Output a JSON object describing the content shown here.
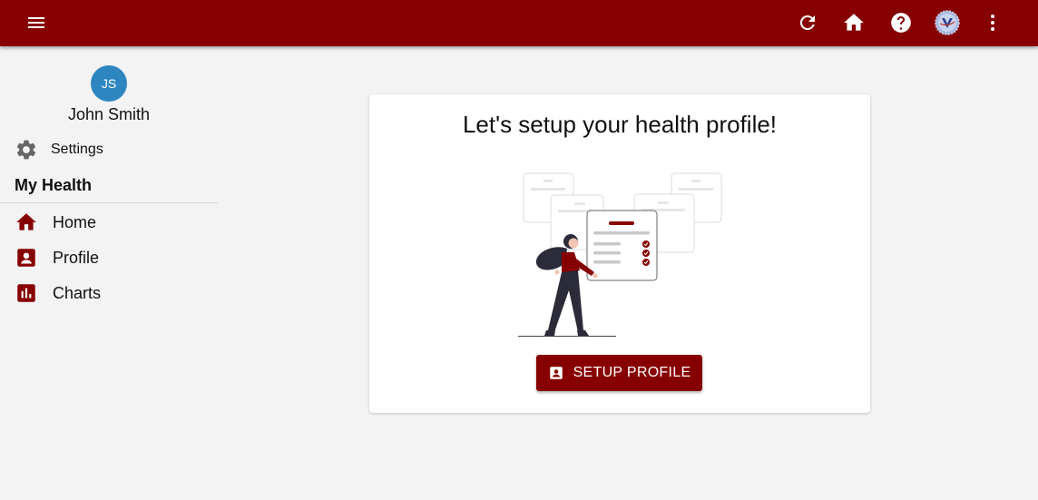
{
  "header": {
    "icons": [
      "menu-icon",
      "refresh-icon",
      "home-icon",
      "help-icon",
      "app-logo-icon",
      "more-vert-icon"
    ],
    "bar_color": "#870000"
  },
  "sidebar": {
    "user": {
      "initials": "JS",
      "name": "John Smith",
      "avatar_color": "#2e86c1"
    },
    "settings_label": "Settings",
    "section_title": "My Health",
    "items": [
      {
        "label": "Home",
        "icon": "home-icon"
      },
      {
        "label": "Profile",
        "icon": "profile-icon"
      },
      {
        "label": "Charts",
        "icon": "chart-icon"
      }
    ]
  },
  "main": {
    "card_title": "Let's setup your health profile!",
    "button_label": "SETUP PROFILE",
    "button_icon": "profile-icon",
    "illustration": "woman-with-checklist-illustration"
  },
  "colors": {
    "accent": "#870000",
    "background": "#f3f3f3"
  }
}
